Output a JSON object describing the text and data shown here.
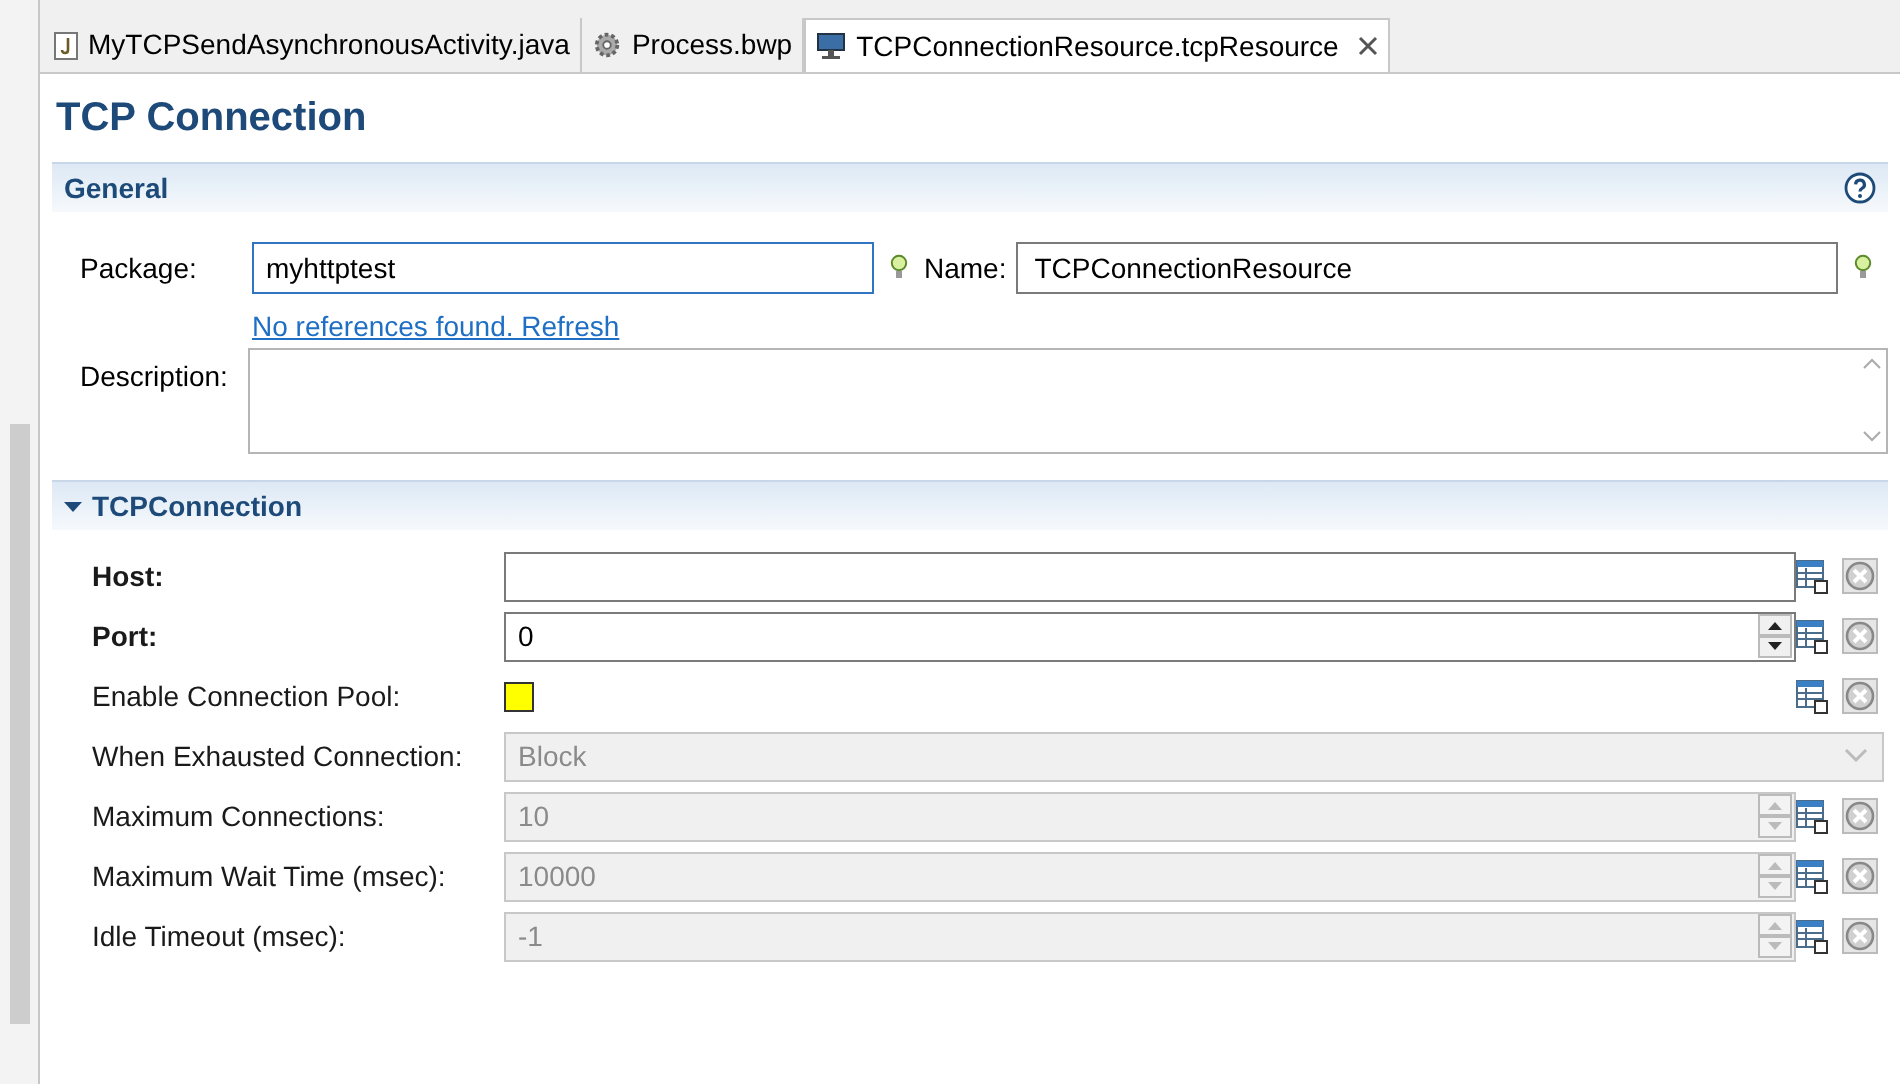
{
  "tabs": [
    {
      "label": "MyTCPSendAsynchronousActivity.java",
      "kind": "java",
      "selected": false
    },
    {
      "label": "Process.bwp",
      "kind": "process",
      "selected": false
    },
    {
      "label": "TCPConnectionResource.tcpResource",
      "kind": "resource",
      "selected": true
    }
  ],
  "title": "TCP Connection",
  "general": {
    "title": "General",
    "package": {
      "label": "Package:",
      "value": "myhttptest"
    },
    "name": {
      "label": "Name:",
      "value": "TCPConnectionResource"
    },
    "references_link": "No references found. Refresh",
    "description": {
      "label": "Description:"
    }
  },
  "tcp_section": {
    "title": "TCPConnection",
    "expanded": true,
    "rows": [
      {
        "label": "Host:",
        "kind": "text",
        "required": true,
        "disabled": false,
        "value": ""
      },
      {
        "label": "Port:",
        "kind": "spinner",
        "required": true,
        "disabled": false,
        "value": "0"
      },
      {
        "label": "Enable Connection Pool:",
        "kind": "checkbox",
        "required": false,
        "disabled": false,
        "checked": false
      },
      {
        "label": "When Exhausted Connection:",
        "kind": "select",
        "required": false,
        "disabled": true,
        "value": "Block"
      },
      {
        "label": "Maximum Connections:",
        "kind": "spinner",
        "required": false,
        "disabled": true,
        "value": "10"
      },
      {
        "label": "Maximum Wait Time (msec):",
        "kind": "spinner",
        "required": false,
        "disabled": true,
        "value": "10000"
      },
      {
        "label": "Idle Timeout (msec):",
        "kind": "spinner",
        "required": false,
        "disabled": true,
        "value": "-1"
      }
    ]
  }
}
